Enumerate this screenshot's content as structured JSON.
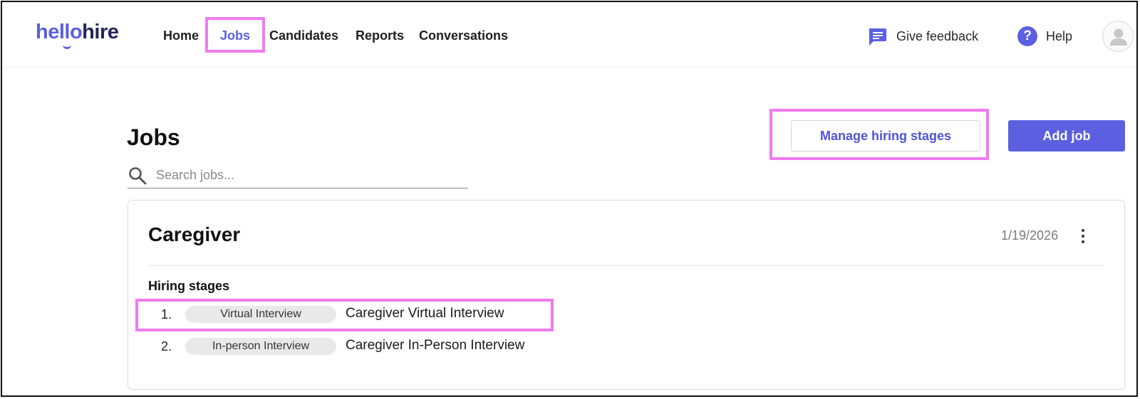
{
  "header": {
    "logo": {
      "part1": "hello",
      "part2": "hire"
    },
    "nav": [
      {
        "label": "Home"
      },
      {
        "label": "Jobs",
        "active": true
      },
      {
        "label": "Candidates"
      },
      {
        "label": "Reports"
      },
      {
        "label": "Conversations"
      }
    ],
    "feedback_label": "Give feedback",
    "help_label": "Help",
    "help_icon_glyph": "?"
  },
  "main": {
    "title": "Jobs",
    "manage_button": "Manage hiring stages",
    "add_button": "Add job",
    "search": {
      "placeholder": "Search jobs...",
      "value": ""
    }
  },
  "jobs": [
    {
      "title": "Caregiver",
      "date": "1/19/2026",
      "stages_heading": "Hiring stages",
      "stages": [
        {
          "number": "1.",
          "type": "Virtual Interview",
          "name": "Caregiver Virtual Interview"
        },
        {
          "number": "2.",
          "type": "In-person Interview",
          "name": "Caregiver In-Person Interview"
        }
      ]
    }
  ],
  "colors": {
    "accent": "#5b5fe0",
    "logo_dark": "#23235a",
    "highlight": "#f07bf0",
    "pill_bg": "#e9e9e9"
  },
  "icons": {
    "feedback": "chat-bubble-icon",
    "help": "help-circle-icon",
    "search": "search-icon",
    "menu": "kebab-menu-icon",
    "avatar": "user-avatar-icon"
  }
}
